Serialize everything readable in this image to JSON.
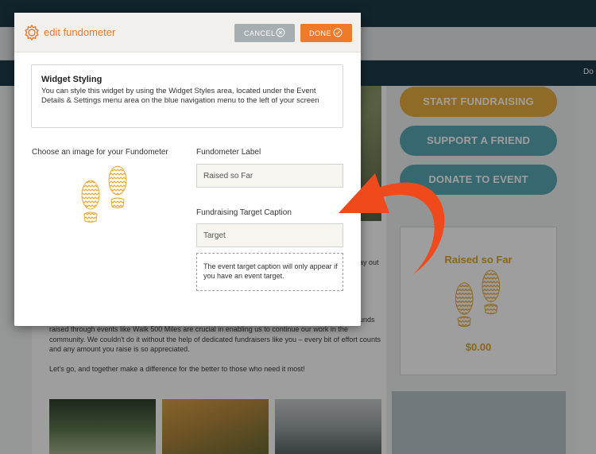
{
  "background": {
    "nav_partial_text": "Do",
    "sidebar_buttons": {
      "start": "START FUNDRAISING",
      "support": "SUPPORT A FRIEND",
      "donate": "DONATE TO EVENT"
    },
    "fundometer_card": {
      "label": "Raised so Far",
      "amount": "$0.00"
    },
    "cut_text_1": "ay out",
    "cut_text_2": "unds",
    "paragraph_1": "raised through events like Walk 500 Miles are crucial in enabling us to continue our work in the community. We couldn't do it without the help of dedicated fundraisers like you – every bit of effort counts and any amount you raise is so appreciated.",
    "paragraph_2": "Let's go, and together make a difference for the better to those who need it most!"
  },
  "modal": {
    "title": "edit fundometer",
    "cancel_label": "CANCEL",
    "done_label": "DONE",
    "info_box": {
      "title": "Widget Styling",
      "text": "You can style this widget by using the Widget Styles area, located under the Event Details & Settings menu area on the blue navigation menu to the left of your screen"
    },
    "image_chooser_label": "Choose an image for your Fundometer",
    "fundometer_label": {
      "label": "Fundometer Label",
      "value": "Raised so Far"
    },
    "target_caption": {
      "label": "Fundraising Target Caption",
      "value": "Target"
    },
    "note": "The event target caption will only appear if you have an event target."
  },
  "colors": {
    "accent_orange": "#ee7a2a",
    "gold": "#e8ad3f",
    "teal": "#5ba9b4",
    "arrow_red": "#f04a1c",
    "nav_dark": "#1e3d4c"
  },
  "icons": {
    "modal": "gear-icon",
    "cancel": "close-circle-icon",
    "done": "check-circle-icon",
    "fundometer_image": "footprints-icon",
    "pointer": "curved-arrow-icon"
  }
}
